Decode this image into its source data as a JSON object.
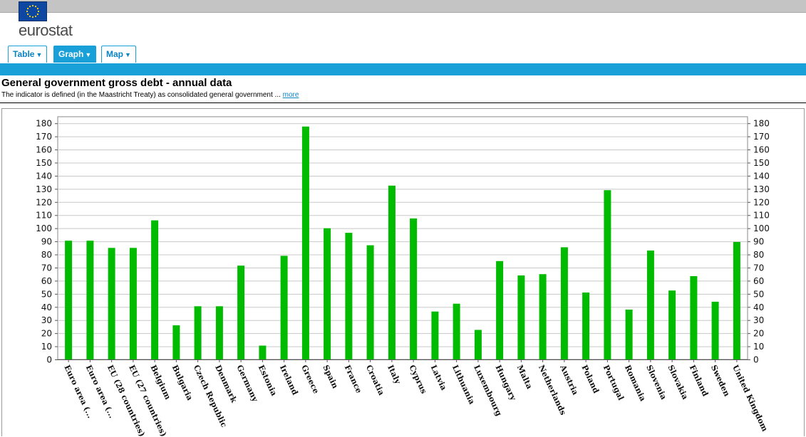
{
  "header": {
    "brand": "eurostat",
    "tabs": [
      {
        "label": "Table",
        "active": false
      },
      {
        "label": "Graph",
        "active": true
      },
      {
        "label": "Map",
        "active": false
      }
    ]
  },
  "dataset": {
    "title": "General government gross debt - annual data",
    "description": "The indicator is defined (in the Maastricht Treaty) as consolidated general government ...",
    "more_label": "more"
  },
  "colors": {
    "bar": "#00bb00",
    "accent": "#1aa0d8",
    "flag": "#0e47a1"
  },
  "chart_data": {
    "type": "bar",
    "title": "",
    "xlabel": "",
    "ylabel": "",
    "ylim": [
      0,
      185
    ],
    "yticks": [
      0,
      10,
      20,
      30,
      40,
      50,
      60,
      70,
      80,
      90,
      100,
      110,
      120,
      130,
      140,
      150,
      160,
      170,
      180
    ],
    "grid": true,
    "legend": "none",
    "categories": [
      "Euro area (...",
      "Euro area (...",
      "EU (28 countries)",
      "EU (27 countries)",
      "Belgium",
      "Bulgaria",
      "Czech Republic",
      "Denmark",
      "Germany",
      "Estonia",
      "Ireland",
      "Greece",
      "Spain",
      "France",
      "Croatia",
      "Italy",
      "Cyprus",
      "Latvia",
      "Lithuania",
      "Luxembourg",
      "Hungary",
      "Malta",
      "Netherlands",
      "Austria",
      "Poland",
      "Portugal",
      "Romania",
      "Slovenia",
      "Slovakia",
      "Finland",
      "Sweden",
      "United Kingdom"
    ],
    "values": [
      90.5,
      90.5,
      85,
      85,
      106,
      26,
      40.5,
      40.5,
      71.5,
      10.5,
      79,
      177.5,
      100,
      96.5,
      87,
      132.5,
      107.5,
      36.5,
      42.5,
      22.5,
      75,
      64,
      65,
      85.5,
      51,
      129,
      38,
      83,
      52.5,
      63.5,
      44,
      89.5
    ]
  }
}
